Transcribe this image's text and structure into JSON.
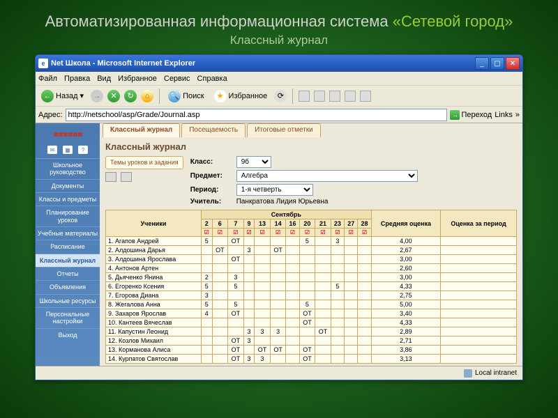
{
  "slide": {
    "title_a": "Автоматизированная информационная система ",
    "title_b": "«Сетевой город»",
    "subtitle": "Классный журнал"
  },
  "window": {
    "title": "Net Школа - Microsoft Internet Explorer",
    "menu": [
      "Файл",
      "Правка",
      "Вид",
      "Избранное",
      "Сервис",
      "Справка"
    ],
    "back": "Назад",
    "search": "Поиск",
    "favorites": "Избранное",
    "addr_label": "Адрес:",
    "url": "http://netschool/asp/Grade/Journal.asp",
    "go": "Переход",
    "links": "Links",
    "status": "Local intranet"
  },
  "sidebar": {
    "items": [
      "Школьное руководство",
      "Документы",
      "Классы и предметы",
      "Планирование уроков",
      "Учебные материалы",
      "Расписание",
      "Классный журнал",
      "Отчеты",
      "Объявления",
      "Школьные ресурсы",
      "Персональные настройки",
      "Выход"
    ],
    "active_index": 6
  },
  "tabs": {
    "items": [
      "Классный журнал",
      "Посещаемость",
      "Итоговые отметки"
    ],
    "active_index": 0
  },
  "page": {
    "title": "Классный журнал",
    "lessons_btn": "Темы уроков и задания",
    "labels": {
      "class": "Класс:",
      "subject": "Предмет:",
      "period": "Период:",
      "teacher": "Учитель:"
    },
    "class": "9б",
    "subject": "Алгебра",
    "period": "1-я четверть",
    "teacher": "Панкратова Лидия Юрьевна"
  },
  "grid": {
    "students_header": "Ученики",
    "month": "Сентябрь",
    "days": [
      "2",
      "6",
      "7",
      "9",
      "13",
      "14",
      "16",
      "20",
      "21",
      "23",
      "27",
      "28"
    ],
    "avg_header": "Средняя оценка",
    "period_header": "Оценка за период",
    "rows": [
      {
        "n": "1.",
        "name": "Агапов Андрей",
        "cells": [
          "5",
          "",
          "ОТ",
          "",
          "",
          "",
          "",
          "5",
          "",
          "3",
          "",
          ""
        ],
        "avg": "4,00"
      },
      {
        "n": "2.",
        "name": "Алдошина Дарья",
        "cells": [
          "",
          "ОТ",
          "",
          "3",
          "",
          "ОТ",
          "",
          "",
          "",
          "",
          "",
          ""
        ],
        "avg": "2,67"
      },
      {
        "n": "3.",
        "name": "Алдошина Ярослава",
        "cells": [
          "",
          "",
          "ОТ",
          "",
          "",
          "",
          "",
          "",
          "",
          "",
          "",
          ""
        ],
        "avg": "3,00"
      },
      {
        "n": "4.",
        "name": "Антонов Артен",
        "cells": [
          "",
          "",
          "",
          "",
          "",
          "",
          "",
          "",
          "",
          "",
          "",
          ""
        ],
        "avg": "2,60"
      },
      {
        "n": "5.",
        "name": "Дьяченко Янина",
        "cells": [
          "2",
          "",
          "3",
          "",
          "",
          "",
          "",
          "",
          "",
          "",
          "",
          ""
        ],
        "avg": "3,00"
      },
      {
        "n": "6.",
        "name": "Егоренко Ксения",
        "cells": [
          "5",
          "",
          "5",
          "",
          "",
          "",
          "",
          "",
          "",
          "5",
          "",
          ""
        ],
        "avg": "4,33"
      },
      {
        "n": "7.",
        "name": "Егорова Диана",
        "cells": [
          "3",
          "",
          "",
          "",
          "",
          "",
          "",
          "",
          "",
          "",
          "",
          ""
        ],
        "avg": "2,75"
      },
      {
        "n": "8.",
        "name": "Жегалова Анна",
        "cells": [
          "5",
          "",
          "5",
          "",
          "",
          "",
          "",
          "5",
          "",
          "",
          "",
          ""
        ],
        "avg": "5,00"
      },
      {
        "n": "9.",
        "name": "Захаров Ярослав",
        "cells": [
          "4",
          "",
          "ОТ",
          "",
          "",
          "",
          "",
          "ОТ",
          "",
          "",
          "",
          ""
        ],
        "avg": "3,40"
      },
      {
        "n": "10.",
        "name": "Кантеев Вячеслав",
        "cells": [
          "",
          "",
          "",
          "",
          "",
          "",
          "",
          "ОТ",
          "",
          "",
          "",
          ""
        ],
        "avg": "4,33"
      },
      {
        "n": "11.",
        "name": "Капустин Леонид",
        "cells": [
          "",
          "",
          "",
          "3",
          "3",
          "3",
          "",
          "",
          "ОТ",
          "",
          "",
          ""
        ],
        "avg": "2,89"
      },
      {
        "n": "12.",
        "name": "Козлов Михаил",
        "cells": [
          "",
          "",
          "ОТ",
          "3",
          "",
          "",
          "",
          "",
          "",
          "",
          "",
          ""
        ],
        "avg": "2,71"
      },
      {
        "n": "13.",
        "name": "Корманова Алиса",
        "cells": [
          "",
          "",
          "ОТ",
          "",
          "ОТ",
          "ОТ",
          "",
          "ОТ",
          "",
          "",
          "",
          ""
        ],
        "avg": "3,86"
      },
      {
        "n": "14.",
        "name": "Курпатов Святослав",
        "cells": [
          "",
          "",
          "ОТ",
          "3",
          "3",
          "",
          "",
          "ОТ",
          "",
          "",
          "",
          ""
        ],
        "avg": "3,13"
      }
    ]
  }
}
